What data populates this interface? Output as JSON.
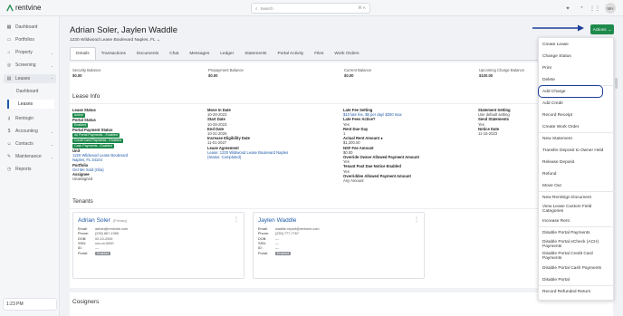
{
  "app": {
    "logo": "rentvine",
    "search_placeholder": "Search",
    "search_shortcut": "⌘ K",
    "user_initials": "MH"
  },
  "sidebar": {
    "items": [
      {
        "label": "Dashboard",
        "icon": "dashboard-icon"
      },
      {
        "label": "Portfolios",
        "icon": "folder-icon"
      },
      {
        "label": "Property",
        "icon": "home-icon"
      },
      {
        "label": "Screening",
        "icon": "screening-icon"
      },
      {
        "label": "Leases",
        "icon": "lease-icon"
      }
    ],
    "lease_sub": [
      "Dashboard",
      "Leases"
    ],
    "items2": [
      {
        "label": "Rentogin",
        "icon": "key-icon"
      },
      {
        "label": "Accounting",
        "icon": "dollar-icon"
      },
      {
        "label": "Contacts",
        "icon": "contacts-icon"
      },
      {
        "label": "Maintenance",
        "icon": "wrench-icon"
      },
      {
        "label": "Reports",
        "icon": "reports-icon"
      }
    ],
    "time": "1:23 PM"
  },
  "header": {
    "title": "Adrian Soler, Jaylen Waddle",
    "address": "1220 Wildwood Lease Boulevard Naples, FL",
    "actions_label": "Actions"
  },
  "tabs": [
    "Details",
    "Transactions",
    "Documents",
    "Chat",
    "Messages",
    "Ledger",
    "Statements",
    "Portal Activity",
    "Files",
    "Work Orders"
  ],
  "balances": [
    {
      "label": "Security Balance",
      "value": "$0.00"
    },
    {
      "label": "Prepayment Balance",
      "value": "$0.00"
    },
    {
      "label": "Current Balance",
      "value": "$0.00"
    },
    {
      "label": "Upcoming Charge Balance",
      "value": "$100.00"
    }
  ],
  "lease_info": {
    "title": "Lease Info",
    "col1": {
      "lease_status_label": "Lease Status",
      "lease_status": "Active",
      "portal_status_label": "Portal Status",
      "portal_status": "Enabled",
      "payment_status_label": "Portal Payment Status",
      "payment_pills": [
        "All Portal Payments - Enabled",
        "Credit Card Payments - Enabled",
        "Cash Payments - Enabled"
      ],
      "unit_label": "Unit",
      "unit_line1": "1220 Wildwood Lease Boulevard",
      "unit_line2": "Naples, FL 34104",
      "portfolio_label": "Portfolio",
      "portfolio": "Get Me Sold (Glia)",
      "assignee_label": "Assignee",
      "assignee": "Unassigned"
    },
    "col2": {
      "move_in_label": "Move In Date",
      "move_in": "10-28-2023",
      "start_label": "Start Date",
      "start": "10-28-2023",
      "end_label": "End Date",
      "end": "10-31-2026",
      "increase_label": "Increase Eligibility Date",
      "increase": "11-01-2027",
      "agreement_label": "Lease Agreement",
      "agreement": "Lease: 1220 Wildwood Lease Boulevard Naples",
      "agreement_status": "(Status: Completed)"
    },
    "col3": {
      "late_fee_label": "Late Fee Setting",
      "late_fee": "$10 late fee, $5 per day/ $300 max",
      "late_active_label": "Late Fees Active?",
      "late_active": "Yes",
      "rent_due_label": "Rent Due Day",
      "rent_due": "1",
      "actual_rent_label": "Actual Rent Amount",
      "actual_rent": "$1,200.00",
      "nsf_label": "NSF Fee Amount",
      "nsf": "$0.00",
      "override_label": "Override Owner Allowed Payment Amount",
      "override": "Yes",
      "tenant_past_label": "Tenant Past Due Notice Enabled",
      "tenant_past": "Yes",
      "overridden_label": "Overridden Allowed Payment Amount",
      "overridden": "Any Amount"
    },
    "col4": {
      "stmt_setting_label": "Statement Setting",
      "stmt_setting": "Use default setting",
      "send_stmt_label": "Send Statements",
      "send_stmt": "Yes",
      "notice_label": "Notice Date",
      "notice": "11-15-2023"
    }
  },
  "tenants": {
    "title": "Tenants",
    "list": [
      {
        "name": "Adrian Soler",
        "primary": "(Primary)",
        "email": "adrian@rentvine.com",
        "phone": "(239) 867-1955",
        "dob": "02-10-2000",
        "ssn": "xxx-xx-0000",
        "id": "—",
        "portal": "Enabled"
      },
      {
        "name": "Jaylen Waddle",
        "primary": "",
        "email": "waddle.report@rentvine.com",
        "phone": "(239) 777-7767",
        "dob": "—",
        "ssn": "—",
        "id": "—",
        "portal": "Enabled"
      }
    ],
    "labels": {
      "email": "Email:",
      "phone": "Phone:",
      "dob": "DOB:",
      "ssn": "SSN:",
      "id": "ID:",
      "portal": "Portal:"
    }
  },
  "cosigners": {
    "title": "Cosigners"
  },
  "actions_menu": [
    "Create Lease",
    "Change Status",
    "Print",
    "Delete",
    "Add Charge",
    "Add Credit",
    "Record Receipt",
    "Create Work Order",
    "New Statement",
    "Transfer Deposit to Owner Held",
    "Release Deposit",
    "Refund",
    "Move Out",
    "New RentSign Document",
    "View Lease Custom Field Categories",
    "Increase Rent",
    "Disable Portal Payments",
    "Disable Portal eCheck (ACH) Payments",
    "Disable Portal Credit Card Payments",
    "Disable Portal Cash Payments",
    "Disable Portal",
    "Record Refunded Return"
  ],
  "colors": {
    "accent": "#1e8a4c",
    "link": "#1e5aa8",
    "highlight": "#1e3f99"
  }
}
